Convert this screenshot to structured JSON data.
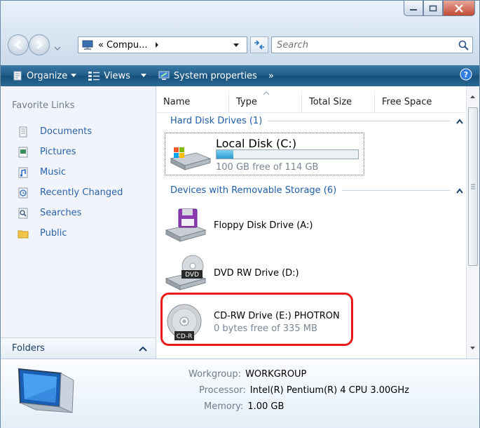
{
  "window": {
    "title_buttons": [
      "minimize",
      "maximize",
      "close"
    ]
  },
  "nav": {
    "breadcrumb_prefix": "«",
    "breadcrumb": "Compu...",
    "search_placeholder": "Search"
  },
  "toolbar": {
    "items": [
      {
        "label": "Organize",
        "icon": "organize-icon",
        "has_dropdown": true
      },
      {
        "label": "Views",
        "icon": "views-icon",
        "has_dropdown": true
      },
      {
        "label": "System properties",
        "icon": "system-properties-icon",
        "has_dropdown": false
      }
    ],
    "more": "»",
    "help_icon": "help-icon"
  },
  "sidebar": {
    "title": "Favorite Links",
    "items": [
      {
        "label": "Documents",
        "icon": "documents-icon"
      },
      {
        "label": "Pictures",
        "icon": "pictures-icon"
      },
      {
        "label": "Music",
        "icon": "music-icon"
      },
      {
        "label": "Recently Changed",
        "icon": "recently-changed-icon"
      },
      {
        "label": "Searches",
        "icon": "searches-icon"
      },
      {
        "label": "Public",
        "icon": "public-icon"
      }
    ],
    "folders_label": "Folders"
  },
  "columns": [
    "Name",
    "Type",
    "Total Size",
    "Free Space"
  ],
  "groups": {
    "hard_disks": {
      "title": "Hard Disk Drives (1)",
      "items": [
        {
          "name": "Local Disk (C:)",
          "free": "100 GB free of 114 GB",
          "used_fraction": 0.12
        }
      ]
    },
    "removable": {
      "title": "Devices with Removable Storage (6)",
      "items": [
        {
          "name": "Floppy Disk Drive (A:)",
          "icon": "floppy-drive-icon"
        },
        {
          "name": "DVD RW Drive (D:)",
          "icon": "dvd-drive-icon",
          "badge": "DVD"
        },
        {
          "name": "CD-RW Drive (E:) PHOTRON",
          "free": "0 bytes free of 335 MB",
          "icon": "cd-drive-icon",
          "badge": "CD-R"
        }
      ]
    }
  },
  "details": {
    "workgroup_label": "Workgroup:",
    "workgroup": "WORKGROUP",
    "processor_label": "Processor:",
    "processor": "Intel(R) Pentium(R) 4 CPU 3.00GHz",
    "memory_label": "Memory:",
    "memory": "1.00 GB"
  },
  "colors": {
    "highlight": "#e81a1a",
    "link": "#2b62a8",
    "group_header": "#1f5ea8",
    "toolbar": "#1f5a86"
  }
}
